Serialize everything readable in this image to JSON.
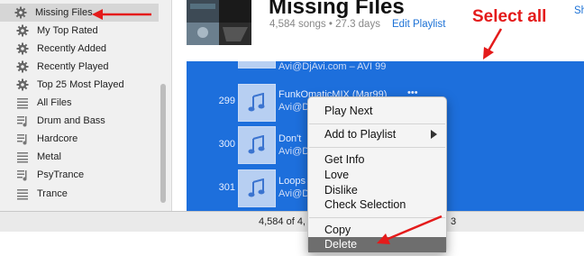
{
  "sidebar": {
    "items": [
      {
        "label": "Missing Files",
        "icon": "gear-icon",
        "selected": true
      },
      {
        "label": "My Top Rated",
        "icon": "gear-icon"
      },
      {
        "label": "Recently Added",
        "icon": "gear-icon"
      },
      {
        "label": "Recently Played",
        "icon": "gear-icon"
      },
      {
        "label": "Top 25 Most Played",
        "icon": "gear-icon"
      },
      {
        "label": "All Files",
        "icon": "playlist-icon"
      },
      {
        "label": "Drum and Bass",
        "icon": "playlist-icon"
      },
      {
        "label": "Hardcore",
        "icon": "playlist-icon"
      },
      {
        "label": "Metal",
        "icon": "playlist-icon"
      },
      {
        "label": "PsyTrance",
        "icon": "playlist-icon"
      },
      {
        "label": "Trance",
        "icon": "playlist-icon"
      }
    ]
  },
  "header": {
    "title": "Missing Files",
    "subtitle": "4,584 songs • 27.3 days",
    "edit_playlist": "Edit Playlist",
    "show_link": "Sh"
  },
  "annotation": {
    "text": "Select all",
    "color": "#e41b1b"
  },
  "songs": [
    {
      "num": "299",
      "title": "FunkOmaticMIX (Mar99)",
      "artist": "Avi@DjAvi.com",
      "dots": "•••"
    },
    {
      "num": "300",
      "title": "Don't",
      "artist": "Avi@D",
      "dots": ""
    },
    {
      "num": "301",
      "title": "Loops",
      "artist": "Avi@D",
      "dots": ""
    }
  ],
  "songs_top_partial": {
    "artist": "Avi@DjAvi.com – AVI 99"
  },
  "context_menu": {
    "items": [
      {
        "label": "Play Next"
      },
      {
        "label": "Add to Playlist",
        "submenu": true
      },
      {
        "label": "Get Info"
      },
      {
        "label": "Love"
      },
      {
        "label": "Dislike"
      },
      {
        "label": "Check Selection"
      },
      {
        "label": "Copy"
      },
      {
        "label": "Delete",
        "highlighted": true
      }
    ]
  },
  "statusbar": {
    "text_left": "4,584 of 4,",
    "text_right": "3"
  },
  "colors": {
    "selection_blue": "#1d6fdc",
    "link_blue": "#1d72d6",
    "menu_highlight": "#6e6e6e"
  }
}
